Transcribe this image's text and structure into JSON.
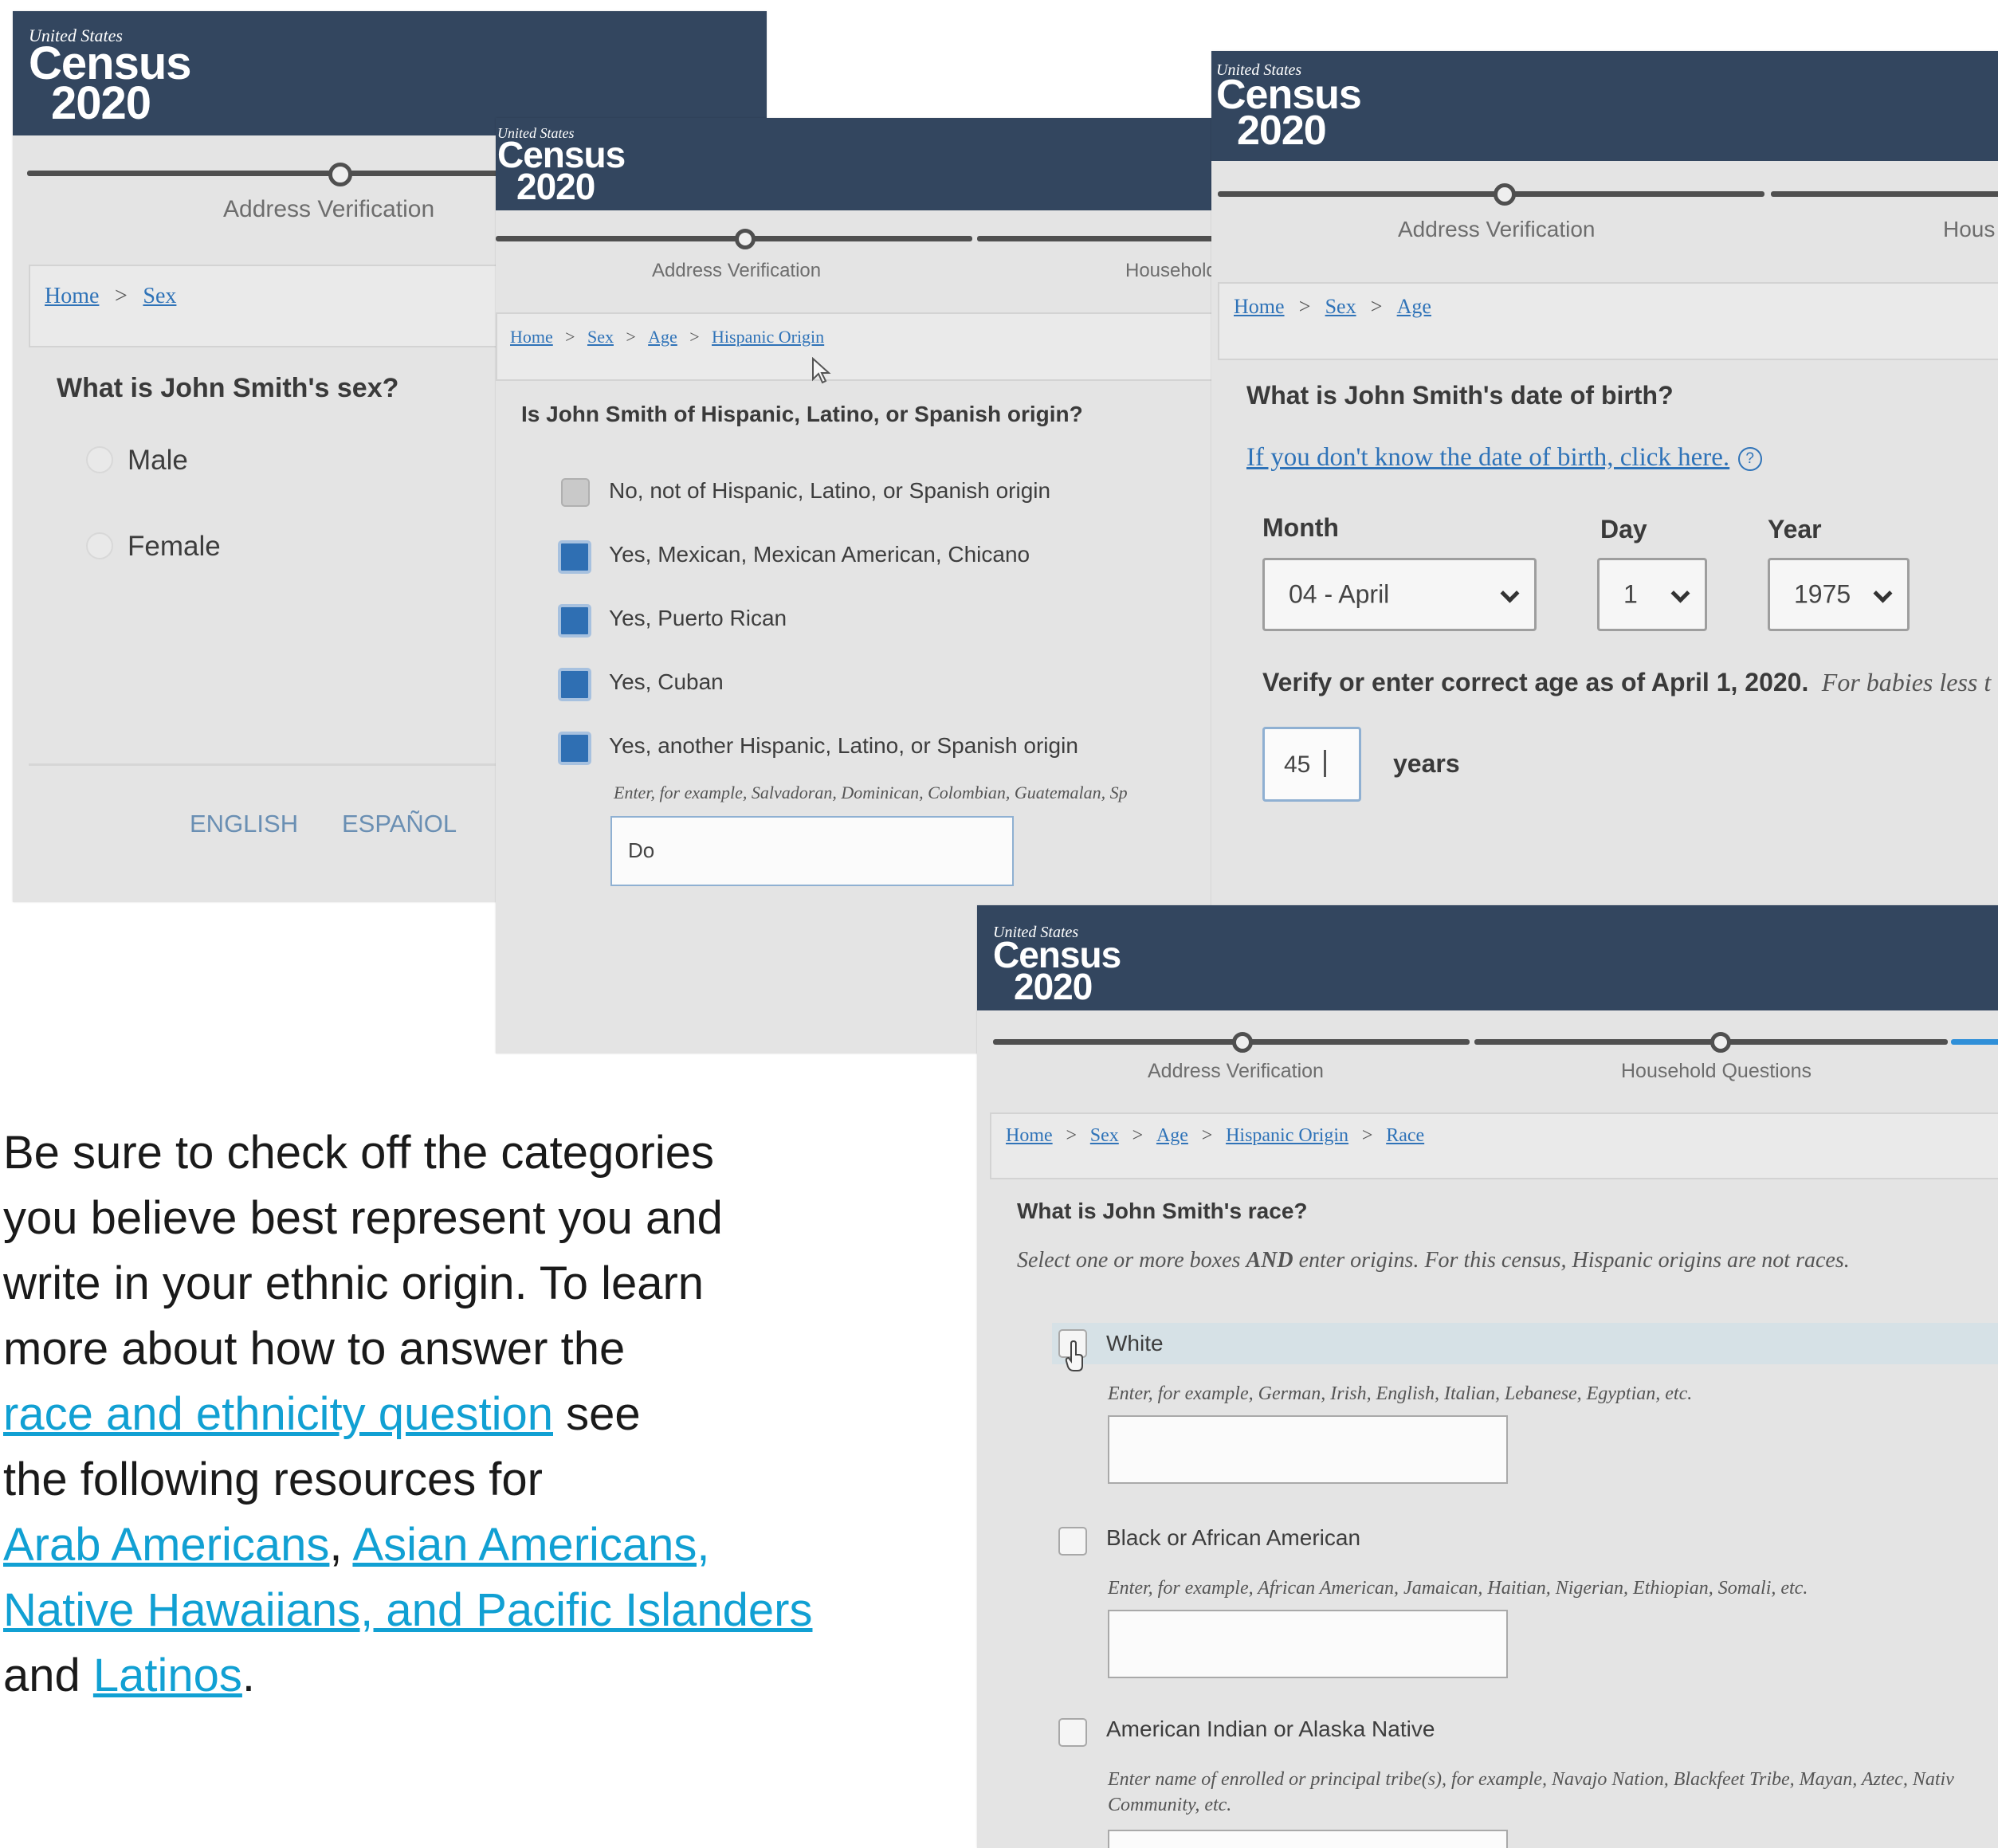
{
  "branding": {
    "us": "United States",
    "word1": "Census",
    "word2": "2020"
  },
  "steps": {
    "address": "Address Verification",
    "household": "Household Questions",
    "household_cut": "Household",
    "household_cut2": "Hous"
  },
  "sex_panel": {
    "breadcrumb": [
      "Home",
      "Sex"
    ],
    "question": "What is John Smith's sex?",
    "options": [
      "Male",
      "Female"
    ],
    "languages": [
      "ENGLISH",
      "ESPAÑOL"
    ]
  },
  "hispanic_panel": {
    "breadcrumb": [
      "Home",
      "Sex",
      "Age",
      "Hispanic Origin"
    ],
    "question": "Is John Smith of Hispanic, Latino, or Spanish origin?",
    "options": [
      {
        "label": "No, not of Hispanic, Latino, or Spanish origin",
        "checked": false
      },
      {
        "label": "Yes, Mexican, Mexican American, Chicano",
        "checked": true
      },
      {
        "label": "Yes, Puerto Rican",
        "checked": true
      },
      {
        "label": "Yes, Cuban",
        "checked": true
      },
      {
        "label": "Yes, another Hispanic, Latino, or Spanish origin",
        "checked": true
      }
    ],
    "hint": "Enter, for example, Salvadoran, Dominican, Colombian, Guatemalan, Sp",
    "input_value": "Do"
  },
  "dob_panel": {
    "breadcrumb": [
      "Home",
      "Sex",
      "Age"
    ],
    "question": "What is John Smith's date of birth?",
    "help_link": "If you don't know the date of birth, click here.",
    "help_icon": "?",
    "labels": {
      "month": "Month",
      "day": "Day",
      "year": "Year"
    },
    "values": {
      "month": "04  -  April",
      "day": "1",
      "year": "1975"
    },
    "age_prompt": "Verify or enter correct age as of April 1, 2020.",
    "age_note": "For babies less t",
    "age_value": "45",
    "age_unit": "years"
  },
  "race_panel": {
    "breadcrumb": [
      "Home",
      "Sex",
      "Age",
      "Hispanic Origin",
      "Race"
    ],
    "question": "What is John Smith's race?",
    "instruction_pre": "Select one or more boxes ",
    "instruction_bold": "AND",
    "instruction_post": " enter origins. For this census, Hispanic origins are not races.",
    "options": [
      {
        "label": "White",
        "hint": "Enter, for example, German, Irish, English, Italian, Lebanese, Egyptian, etc."
      },
      {
        "label": "Black or African American",
        "hint": "Enter, for example, African American, Jamaican, Haitian, Nigerian, Ethiopian, Somali, etc."
      },
      {
        "label": "American Indian or Alaska Native",
        "hint": "Enter name of enrolled or principal tribe(s), for example, Navajo Nation, Blackfeet Tribe, Mayan, Aztec, Nativ",
        "hint2": "Community, etc."
      }
    ]
  },
  "article": {
    "line1": "Be sure to check off the categories",
    "line2": "you believe best represent you and",
    "line3": "write in your ethnic origin. To learn",
    "line4": "more about how to answer the",
    "link_race": "race and ethnicity question",
    "after_race": " see",
    "line6": "the following resources for",
    "link_arab": "Arab Americans",
    "comma": ", ",
    "link_asian_1": "Asian Americans,",
    "link_asian_2": "Native Hawaiians, and Pacific Islanders",
    "and_text": "and ",
    "link_latinos": "Latinos",
    "period": "."
  },
  "colors": {
    "header": "#33465f",
    "link": "#2f73b8",
    "article_link": "#11a0d3",
    "checkbox": "#2f6fb3"
  }
}
